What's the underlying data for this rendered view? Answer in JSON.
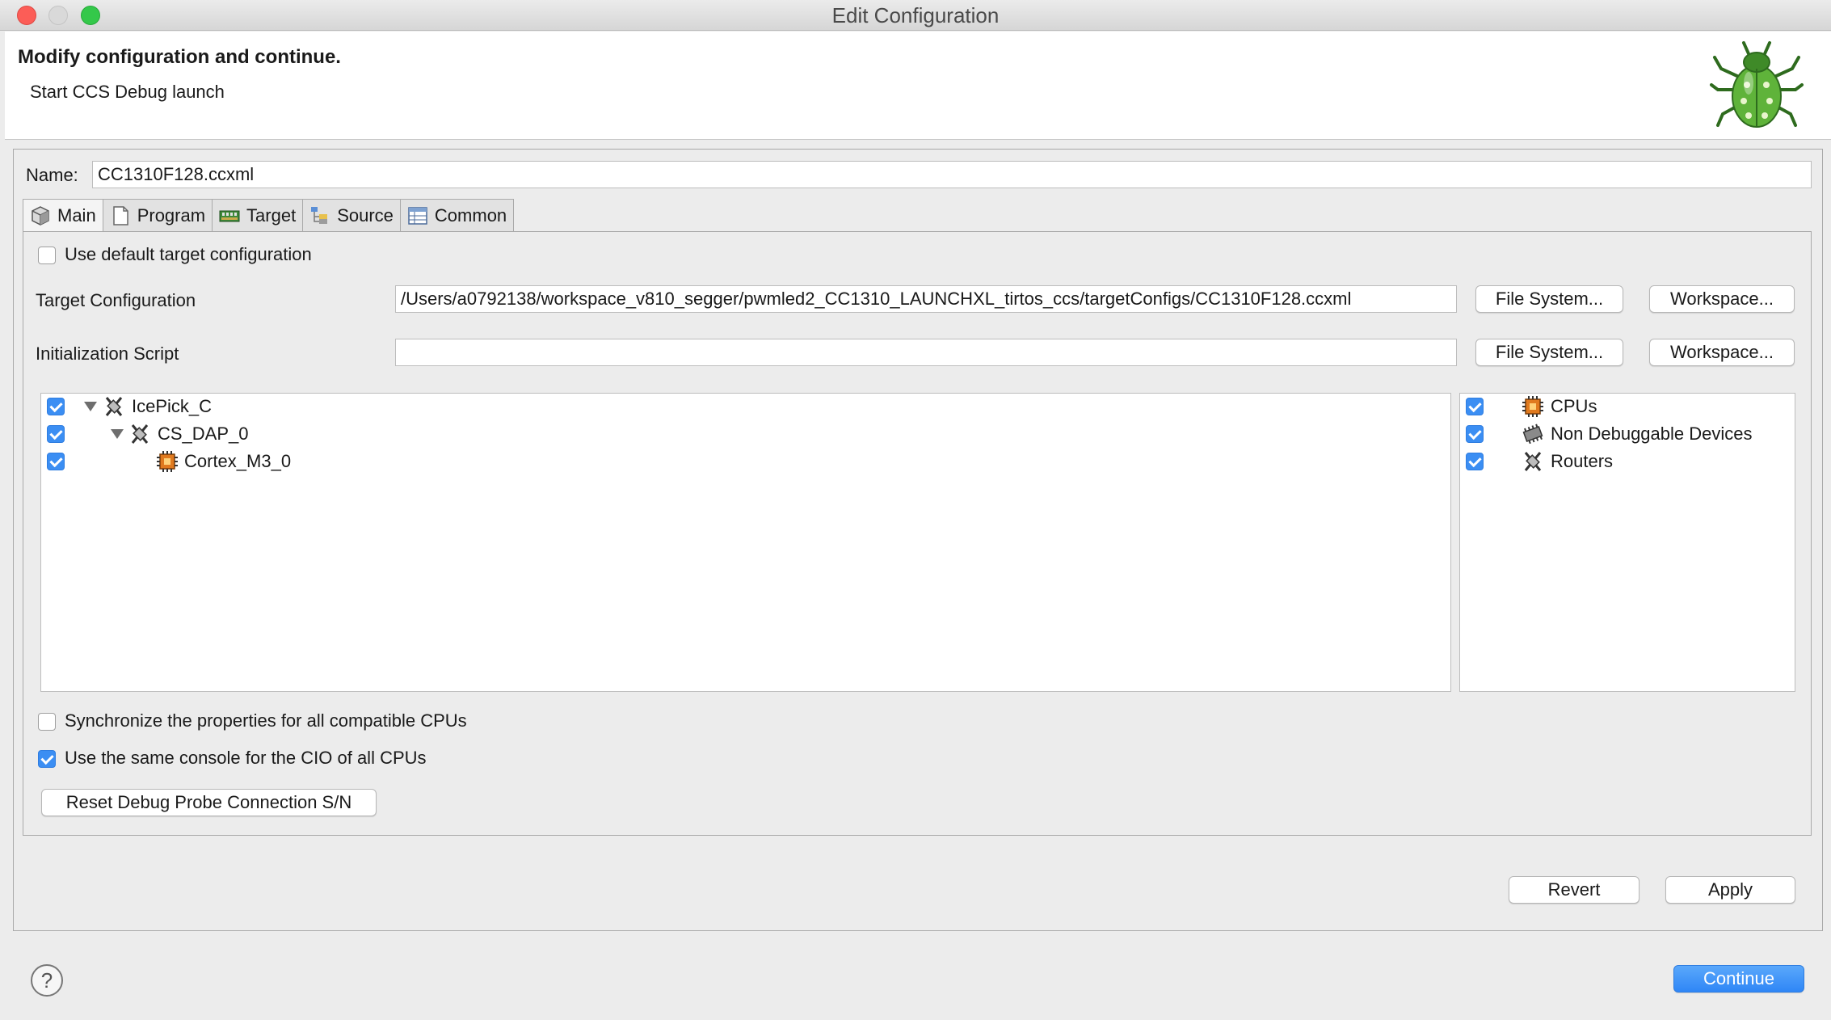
{
  "window": {
    "title": "Edit Configuration"
  },
  "banner": {
    "headline": "Modify configuration and continue.",
    "subline": "Start CCS Debug launch"
  },
  "name": {
    "label": "Name:",
    "value": "CC1310F128.ccxml"
  },
  "tabs": [
    {
      "label": "Main",
      "icon": "cube-icon",
      "active": true
    },
    {
      "label": "Program",
      "icon": "document-icon"
    },
    {
      "label": "Target",
      "icon": "board-icon"
    },
    {
      "label": "Source",
      "icon": "source-tree-icon"
    },
    {
      "label": "Common",
      "icon": "table-icon"
    }
  ],
  "main": {
    "use_default_target": {
      "label": "Use default target configuration",
      "checked": false
    },
    "target_config": {
      "label": "Target Configuration",
      "value": "/Users/a0792138/workspace_v810_segger/pwmled2_CC1310_LAUNCHXL_tirtos_ccs/targetConfigs/CC1310F128.ccxml",
      "file_system": "File System...",
      "workspace": "Workspace..."
    },
    "init_script": {
      "label": "Initialization Script",
      "value": "",
      "file_system": "File System...",
      "workspace": "Workspace..."
    },
    "device_tree": [
      {
        "label": "IcePick_C",
        "checked": true,
        "expanded": true,
        "icon": "router-icon"
      },
      {
        "label": "CS_DAP_0",
        "checked": true,
        "expanded": true,
        "icon": "router-icon"
      },
      {
        "label": "Cortex_M3_0",
        "checked": true,
        "icon": "cpu-icon"
      }
    ],
    "filters": [
      {
        "label": "CPUs",
        "checked": true,
        "icon": "cpu-icon"
      },
      {
        "label": "Non Debuggable Devices",
        "checked": true,
        "icon": "chip-icon"
      },
      {
        "label": "Routers",
        "checked": true,
        "icon": "router-icon"
      }
    ],
    "sync_props": {
      "label": "Synchronize the properties for all compatible CPUs",
      "checked": false
    },
    "same_console": {
      "label": "Use the same console for the CIO of all CPUs",
      "checked": true
    },
    "reset_probe": "Reset Debug Probe Connection S/N"
  },
  "buttons": {
    "revert": "Revert",
    "apply": "Apply",
    "continue": "Continue"
  },
  "colors": {
    "accent": "#3b8ef3",
    "close": "#fc5d57",
    "maximize": "#34c84a"
  }
}
